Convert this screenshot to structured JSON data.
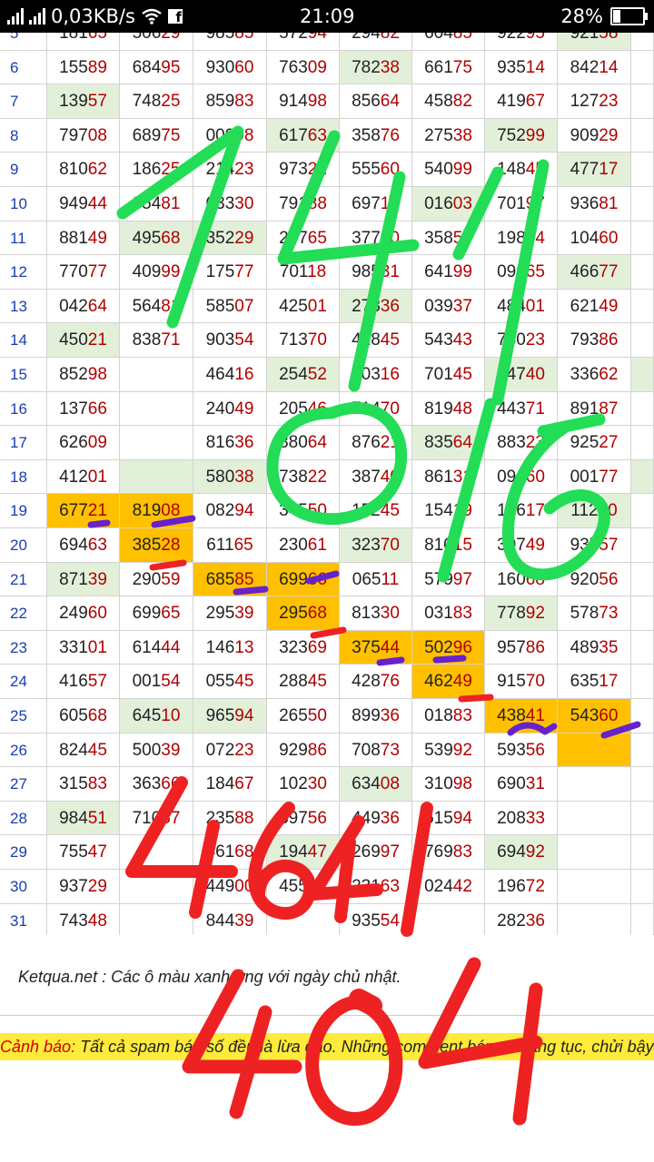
{
  "status_bar": {
    "network_speed": "0,03KB/s",
    "time": "21:09",
    "battery": "28%",
    "battery_level": 0.28,
    "icons": [
      "signal-icon",
      "signal-icon",
      "wifi-icon",
      "facebook-icon",
      "battery-icon"
    ]
  },
  "table": {
    "rows": [
      {
        "day": "6",
        "cells": [
          {
            "v": "15589"
          },
          {
            "v": "68495"
          },
          {
            "v": "93060"
          },
          {
            "v": "76309"
          },
          {
            "v": "78238",
            "c": "green"
          },
          {
            "v": "66175"
          },
          {
            "v": "93514"
          },
          {
            "v": "84214"
          }
        ]
      },
      {
        "day": "7",
        "cells": [
          {
            "v": "13957",
            "c": "green"
          },
          {
            "v": "74825"
          },
          {
            "v": "85983"
          },
          {
            "v": "91498"
          },
          {
            "v": "85664"
          },
          {
            "v": "45882"
          },
          {
            "v": "41967"
          },
          {
            "v": "12723"
          }
        ]
      },
      {
        "day": "8",
        "cells": [
          {
            "v": "79708"
          },
          {
            "v": "68975"
          },
          {
            "v": "00998"
          },
          {
            "v": "61763",
            "c": "green"
          },
          {
            "v": "35876"
          },
          {
            "v": "27538"
          },
          {
            "v": "75299",
            "c": "green"
          },
          {
            "v": "90929"
          }
        ]
      },
      {
        "day": "9",
        "cells": [
          {
            "v": "81062"
          },
          {
            "v": "18625"
          },
          {
            "v": "21423"
          },
          {
            "v": "97322"
          },
          {
            "v": "55560"
          },
          {
            "v": "54099"
          },
          {
            "v": "14845"
          },
          {
            "v": "47717",
            "c": "green"
          }
        ]
      },
      {
        "day": "10",
        "cells": [
          {
            "v": "94944"
          },
          {
            "v": "95481"
          },
          {
            "v": "03330"
          },
          {
            "v": "79188"
          },
          {
            "v": "69710"
          },
          {
            "v": "01603",
            "c": "green"
          },
          {
            "v": "70197"
          },
          {
            "v": "93681"
          }
        ]
      },
      {
        "day": "11",
        "cells": [
          {
            "v": "88149"
          },
          {
            "v": "49568",
            "c": "green"
          },
          {
            "v": "35229",
            "c": "green"
          },
          {
            "v": "24765"
          },
          {
            "v": "37790"
          },
          {
            "v": "35854"
          },
          {
            "v": "19854"
          },
          {
            "v": "10460"
          }
        ]
      },
      {
        "day": "12",
        "cells": [
          {
            "v": "77077"
          },
          {
            "v": "40999"
          },
          {
            "v": "17577"
          },
          {
            "v": "70118"
          },
          {
            "v": "98531"
          },
          {
            "v": "64199"
          },
          {
            "v": "09965"
          },
          {
            "v": "46677",
            "c": "green"
          }
        ]
      },
      {
        "day": "13",
        "cells": [
          {
            "v": "04264"
          },
          {
            "v": "56481"
          },
          {
            "v": "58507"
          },
          {
            "v": "42501"
          },
          {
            "v": "27336",
            "c": "green"
          },
          {
            "v": "03937"
          },
          {
            "v": "48401"
          },
          {
            "v": "62149"
          }
        ]
      },
      {
        "day": "14",
        "cells": [
          {
            "v": "45021",
            "c": "green"
          },
          {
            "v": "83871"
          },
          {
            "v": "90354"
          },
          {
            "v": "71370"
          },
          {
            "v": "41845"
          },
          {
            "v": "54343"
          },
          {
            "v": "78023"
          },
          {
            "v": "79386"
          }
        ]
      },
      {
        "day": "15",
        "cells": [
          {
            "v": "85298"
          },
          {
            "v": ""
          },
          {
            "v": "46416"
          },
          {
            "v": "25452",
            "c": "green"
          },
          {
            "v": "10316"
          },
          {
            "v": "70145"
          },
          {
            "v": "84740",
            "c": "green"
          },
          {
            "v": "33662"
          }
        ]
      },
      {
        "day": "16",
        "cells": [
          {
            "v": "13766"
          },
          {
            "v": ""
          },
          {
            "v": "24049"
          },
          {
            "v": "20546"
          },
          {
            "v": "71470"
          },
          {
            "v": "81948"
          },
          {
            "v": "44371"
          },
          {
            "v": "89187"
          }
        ]
      },
      {
        "day": "17",
        "cells": [
          {
            "v": "62609"
          },
          {
            "v": ""
          },
          {
            "v": "81636"
          },
          {
            "v": "38064"
          },
          {
            "v": "87621"
          },
          {
            "v": "83564",
            "c": "green"
          },
          {
            "v": "88323"
          },
          {
            "v": "92527"
          }
        ]
      },
      {
        "day": "18",
        "cells": [
          {
            "v": "41201"
          },
          {
            "v": "",
            "c": "green"
          },
          {
            "v": "58038",
            "c": "green"
          },
          {
            "v": "73822"
          },
          {
            "v": "38740"
          },
          {
            "v": "86131"
          },
          {
            "v": "09660"
          },
          {
            "v": "00177"
          }
        ]
      },
      {
        "day": "19",
        "cells": [
          {
            "v": "67721",
            "c": "orange"
          },
          {
            "v": "81908",
            "c": "orange"
          },
          {
            "v": "08294"
          },
          {
            "v": "34550"
          },
          {
            "v": "15245"
          },
          {
            "v": "15419"
          },
          {
            "v": "15617"
          },
          {
            "v": "11210",
            "c": "green"
          }
        ]
      },
      {
        "day": "20",
        "cells": [
          {
            "v": "69463"
          },
          {
            "v": "38528",
            "c": "orange"
          },
          {
            "v": "61165"
          },
          {
            "v": "23061"
          },
          {
            "v": "32370",
            "c": "green"
          },
          {
            "v": "81015"
          },
          {
            "v": "30749"
          },
          {
            "v": "93757"
          }
        ]
      },
      {
        "day": "21",
        "cells": [
          {
            "v": "87139",
            "c": "green"
          },
          {
            "v": "29059"
          },
          {
            "v": "68585",
            "c": "orange"
          },
          {
            "v": "69966",
            "c": "orange"
          },
          {
            "v": "06511"
          },
          {
            "v": "57997"
          },
          {
            "v": "16068"
          },
          {
            "v": "92056"
          }
        ]
      },
      {
        "day": "22",
        "cells": [
          {
            "v": "24960"
          },
          {
            "v": "69965"
          },
          {
            "v": "29539"
          },
          {
            "v": "29568",
            "c": "orange"
          },
          {
            "v": "81330"
          },
          {
            "v": "03183"
          },
          {
            "v": "77892",
            "c": "green"
          },
          {
            "v": "57873"
          }
        ]
      },
      {
        "day": "23",
        "cells": [
          {
            "v": "33101"
          },
          {
            "v": "61444"
          },
          {
            "v": "14613"
          },
          {
            "v": "32369"
          },
          {
            "v": "37544",
            "c": "orange"
          },
          {
            "v": "50296",
            "c": "orange"
          },
          {
            "v": "95786"
          },
          {
            "v": "48935"
          }
        ]
      },
      {
        "day": "24",
        "cells": [
          {
            "v": "41657"
          },
          {
            "v": "00154"
          },
          {
            "v": "05545"
          },
          {
            "v": "28845"
          },
          {
            "v": "42876"
          },
          {
            "v": "46249",
            "c": "orange"
          },
          {
            "v": "91570"
          },
          {
            "v": "63517"
          }
        ]
      },
      {
        "day": "25",
        "cells": [
          {
            "v": "60568"
          },
          {
            "v": "64510",
            "c": "green"
          },
          {
            "v": "96594",
            "c": "green"
          },
          {
            "v": "26550"
          },
          {
            "v": "89936"
          },
          {
            "v": "01883"
          },
          {
            "v": "43841",
            "c": "orange"
          },
          {
            "v": "54360",
            "c": "orange"
          }
        ]
      },
      {
        "day": "26",
        "cells": [
          {
            "v": "82445"
          },
          {
            "v": "50039"
          },
          {
            "v": "07223"
          },
          {
            "v": "92986"
          },
          {
            "v": "70873"
          },
          {
            "v": "53992"
          },
          {
            "v": "59356"
          },
          {
            "v": "",
            "c": "orange"
          }
        ]
      },
      {
        "day": "27",
        "cells": [
          {
            "v": "31583"
          },
          {
            "v": "36366"
          },
          {
            "v": "18467"
          },
          {
            "v": "10230"
          },
          {
            "v": "63408",
            "c": "green"
          },
          {
            "v": "31098"
          },
          {
            "v": "69031"
          },
          {
            "v": ""
          }
        ]
      },
      {
        "day": "28",
        "cells": [
          {
            "v": "98451",
            "c": "green"
          },
          {
            "v": "71067"
          },
          {
            "v": "23588"
          },
          {
            "v": "39756"
          },
          {
            "v": "44936"
          },
          {
            "v": "51594"
          },
          {
            "v": "20833"
          },
          {
            "v": ""
          }
        ]
      },
      {
        "day": "29",
        "cells": [
          {
            "v": "75547"
          },
          {
            "v": ""
          },
          {
            "v": "46168"
          },
          {
            "v": "19447",
            "c": "green"
          },
          {
            "v": "26997"
          },
          {
            "v": "76983"
          },
          {
            "v": "69492",
            "c": "green"
          },
          {
            "v": ""
          }
        ]
      },
      {
        "day": "30",
        "cells": [
          {
            "v": "93729"
          },
          {
            "v": ""
          },
          {
            "v": "44900"
          },
          {
            "v": "45514"
          },
          {
            "v": "23163"
          },
          {
            "v": "02442"
          },
          {
            "v": "19672"
          },
          {
            "v": ""
          }
        ]
      },
      {
        "day": "31",
        "cells": [
          {
            "v": "74348"
          },
          {
            "v": ""
          },
          {
            "v": "84439"
          },
          {
            "v": ""
          },
          {
            "v": "93554"
          },
          {
            "v": ""
          },
          {
            "v": "28236"
          },
          {
            "v": ""
          }
        ]
      }
    ]
  },
  "footer": {
    "note": "Ketqua.net : Các ô màu xanh ứng với ngày chủ nhật.",
    "warning_label": "Cảnh báo:",
    "warning_text": " Tất cả spam bán số đều là lừa đảo. Những comment bán số văng tục, chửi bậy"
  },
  "colors": {
    "sunday_green": "#e2f0d9",
    "highlight_orange": "#ffc000",
    "digit_red": "#b00000",
    "day_blue": "#1a3db0",
    "ink_green": "#22dd55",
    "ink_red": "#ee2222",
    "ink_purple": "#6622cc",
    "warning_yellow": "#ffeb3b"
  }
}
